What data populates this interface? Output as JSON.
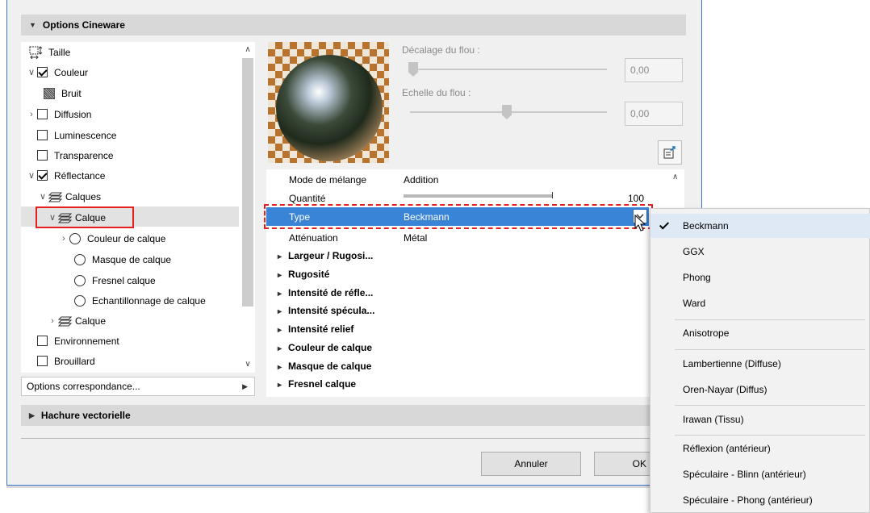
{
  "sections": {
    "options_cineware": "Options Cineware",
    "hachure": "Hachure vectorielle"
  },
  "tree": {
    "items": [
      {
        "label": "Taille"
      },
      {
        "label": "Couleur"
      },
      {
        "label": "Bruit"
      },
      {
        "label": "Diffusion"
      },
      {
        "label": "Luminescence"
      },
      {
        "label": "Transparence"
      },
      {
        "label": "Réflectance"
      },
      {
        "label": "Calques"
      },
      {
        "label": "Calque"
      },
      {
        "label": "Couleur de calque"
      },
      {
        "label": "Masque de calque"
      },
      {
        "label": "Fresnel calque"
      },
      {
        "label": "Echantillonnage de calque"
      },
      {
        "label": "Calque"
      },
      {
        "label": "Environnement"
      },
      {
        "label": "Brouillard"
      }
    ]
  },
  "options_correspondance": "Options correspondance...",
  "blur": {
    "offset_label": "Décalage du flou :",
    "offset_value": "0,00",
    "scale_label": "Echelle du flou :",
    "scale_value": "0,00"
  },
  "props": {
    "rows": [
      {
        "key": "Mode de mélange",
        "value": "Addition"
      },
      {
        "key": "Quantité",
        "value": "100"
      },
      {
        "key": "Type",
        "value": "Beckmann"
      },
      {
        "key": "Atténuation",
        "value": "Métal"
      }
    ],
    "groups": [
      "Largeur / Rugosi...",
      "Rugosité",
      "Intensité de réfle...",
      "Intensité spécula...",
      "Intensité relief",
      "Couleur de calque",
      "Masque de calque",
      "Fresnel calque"
    ],
    "quantity_fraction": 0.995
  },
  "buttons": {
    "cancel": "Annuler",
    "ok": "OK"
  },
  "menu": {
    "items": [
      "Beckmann",
      "GGX",
      "Phong",
      "Ward",
      "Anisotrope",
      "Lambertienne (Diffuse)",
      "Oren-Nayar (Diffus)",
      "Irawan (Tissu)",
      "Réflexion (antérieur)",
      "Spéculaire - Blinn (antérieur)",
      "Spéculaire - Phong (antérieur)"
    ],
    "selected": "Beckmann"
  },
  "colors": {
    "selection": "#3a84d8",
    "highlight_red": "#e51e1e"
  }
}
